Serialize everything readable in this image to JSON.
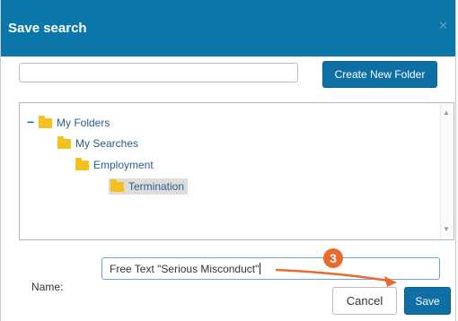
{
  "dialog": {
    "title": "Save search",
    "close_icon": "close-icon"
  },
  "folder_bar": {
    "input_value": "",
    "create_button_label": "Create New Folder"
  },
  "tree": {
    "nodes": [
      {
        "label": "My Folders",
        "expanded": true,
        "icon": "folder-icon",
        "expander_glyph": "−"
      },
      {
        "label": "My Searches",
        "icon": "folder-icon"
      },
      {
        "label": "Employment",
        "icon": "folder-icon"
      },
      {
        "label": "Termination",
        "icon": "folder-icon",
        "selected": true
      }
    ]
  },
  "name_field": {
    "label": "Name:",
    "value": "Free Text \"Serious Misconduct\""
  },
  "buttons": {
    "cancel_label": "Cancel",
    "save_label": "Save"
  },
  "annotation": {
    "step_number": "3",
    "color": "#ea6a2e"
  },
  "colors": {
    "header": "#0a77a8",
    "primary_button": "#0d6fa3",
    "folder": "#f3c01d",
    "link_text": "#2a5d8a"
  }
}
